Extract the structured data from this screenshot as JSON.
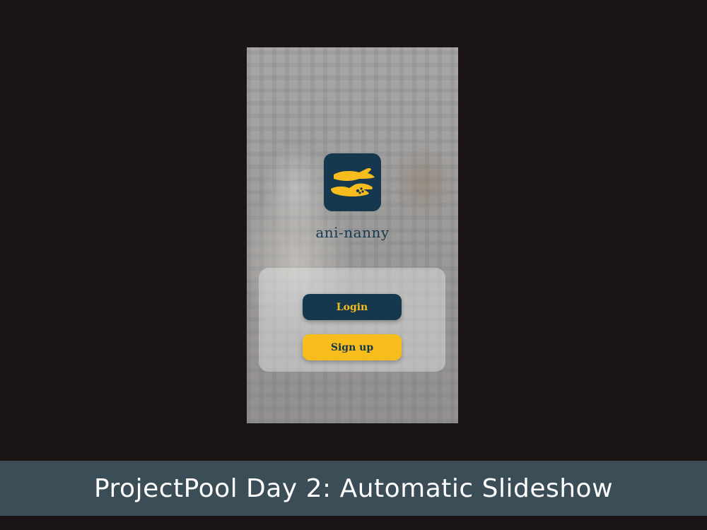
{
  "app": {
    "name": "ani-nanny",
    "logo_icon": "hand-holding-paw-icon"
  },
  "auth": {
    "login_label": "Login",
    "signup_label": "Sign up"
  },
  "banner": {
    "title": "ProjectPool Day 2: Automatic Slideshow"
  },
  "colors": {
    "background": "#1a1414",
    "navy": "#15384f",
    "yellow": "#f6bd1c",
    "banner": "#3b4d57"
  }
}
